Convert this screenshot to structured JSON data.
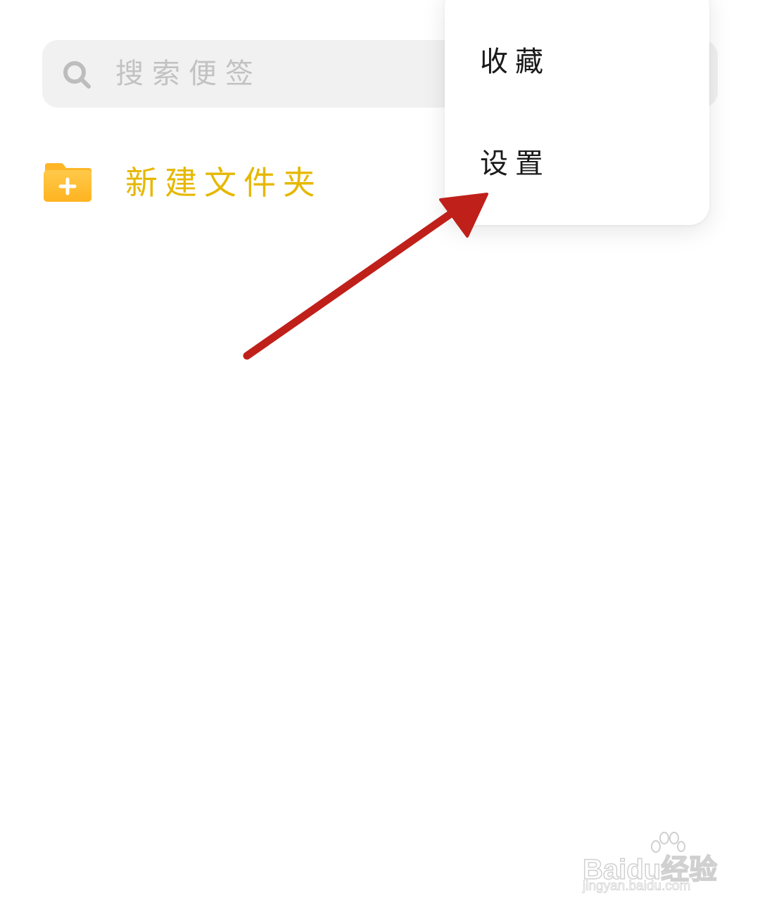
{
  "search": {
    "placeholder": "搜索便签",
    "icon": "search-icon"
  },
  "new_folder": {
    "label": "新建文件夹",
    "icon": "folder-plus-icon",
    "color": "#e6b800"
  },
  "popup_menu": {
    "items": [
      {
        "label": "收藏"
      },
      {
        "label": "设置"
      }
    ]
  },
  "annotation": {
    "type": "arrow",
    "color": "#c0201a",
    "points_to": "设置"
  },
  "watermark": {
    "brand": "Baidu经验",
    "url": "jingyan.baidu.com"
  }
}
